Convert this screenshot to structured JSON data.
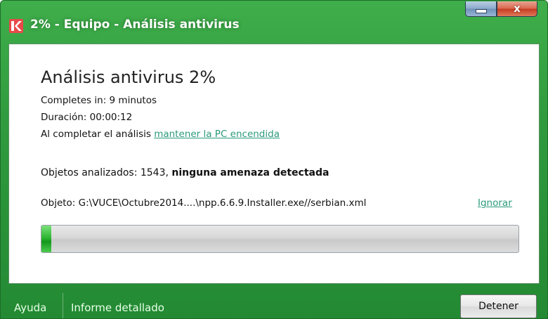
{
  "window": {
    "title": "2% - Equipo - Análisis antivirus",
    "minimize_icon": "minimize-icon",
    "close_glyph": "x",
    "app_icon": "kaspersky-k-icon"
  },
  "scan": {
    "title": "Análisis antivirus 2%",
    "progress": 0.02,
    "completes_in": "Completes in: 9 minutos",
    "duration": "Duración: 00:00:12",
    "on_complete_prefix": "Al completar el análisis ",
    "on_complete_link": "mantener la PC encendida",
    "objects_prefix": "Objetos analizados: 1543, ",
    "objects_status": "ninguna amenaza detectada",
    "object_path": "Objeto: G:\\VUCE\\Octubre2014....\\npp.6.6.9.Installer.exe//serbian.xml",
    "ignore_link": "Ignorar"
  },
  "footer": {
    "help": "Ayuda",
    "report": "Informe detallado",
    "stop_button": "Detener"
  },
  "colors": {
    "frame_green": "#2f9a3e",
    "link_teal": "#2a9a7a",
    "progress_green": "#27b12d"
  }
}
